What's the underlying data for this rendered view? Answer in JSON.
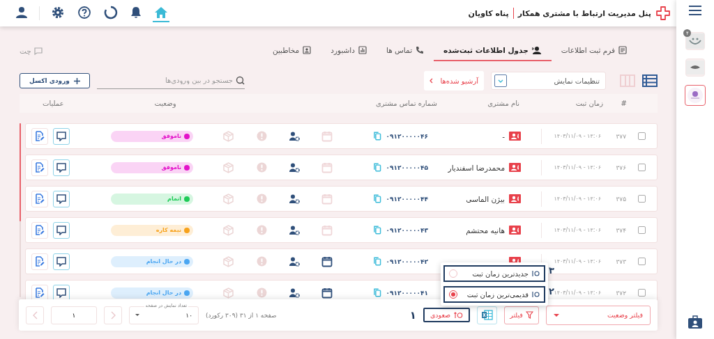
{
  "header": {
    "title": "پنل مدیریت ارتباط با مشتری همکار",
    "company": "پناه کاویان",
    "nav": [
      {
        "kind": "home",
        "selected": true
      },
      {
        "kind": "bell",
        "selected": false
      },
      {
        "kind": "loader",
        "selected": false
      },
      {
        "kind": "help",
        "selected": false
      },
      {
        "kind": "settings",
        "selected": false
      },
      {
        "kind": "user",
        "selected": false
      }
    ]
  },
  "sidebar": {
    "apps": [
      {
        "kind": "smile",
        "badge": "۴",
        "selected": false
      },
      {
        "kind": "eye",
        "selected": false
      },
      {
        "kind": "flower",
        "selected": true
      }
    ]
  },
  "tabs": [
    {
      "label": "فرم ثبت اطلاعات",
      "kind": "form",
      "selected": false
    },
    {
      "label": "جدول اطلاعات ثبت‌شده",
      "kind": "table",
      "selected": true
    },
    {
      "label": "تماس ها",
      "kind": "phone",
      "selected": false
    },
    {
      "label": "داشبورد",
      "kind": "chart",
      "selected": false
    },
    {
      "label": "مخاطبین",
      "kind": "contacts",
      "selected": false
    }
  ],
  "chat_link": "چت",
  "toolbar": {
    "views": [
      {
        "kind": "list",
        "selected": true
      },
      {
        "kind": "columns",
        "selected": false
      }
    ],
    "display_settings": "تنظیمات نمایش",
    "archive": "آرشیو شده‌ها",
    "search": {
      "placeholder": "جستجو در بین ورودی‌ها"
    },
    "excel_button": "ورودی اکسل"
  },
  "table": {
    "columns": [
      "#",
      "زمان ثبت",
      "نام مشتری",
      "شماره تماس مشتری",
      "وضعیت",
      "عملیات"
    ],
    "rows": [
      {
        "number": "۳۷۷",
        "time": "۱۴۰۳/۱۱/۰۹ - ۱۴:۰۶",
        "name": "-",
        "contact_icon": true,
        "phone": "۰۹۱۲۰۰۰۰۰۴۶",
        "scheduled": false,
        "checked": false,
        "status": {
          "label": "ناموفق",
          "color": "#e312c9"
        }
      },
      {
        "number": "۳۷۶",
        "time": "۱۴۰۳/۱۱/۰۹ - ۱۴:۰۶",
        "name": "محمدرضا اسفندیار",
        "contact_icon": true,
        "phone": "۰۹۱۲۰۰۰۰۰۴۵",
        "scheduled": false,
        "checked": false,
        "status": {
          "label": "ناموفق",
          "color": "#e312c9"
        }
      },
      {
        "number": "۳۷۵",
        "time": "۱۴۰۳/۱۱/۰۹ - ۱۴:۰۶",
        "name": "بیژن الماسی",
        "contact_icon": true,
        "phone": "۰۹۱۲۰۰۰۰۰۴۴",
        "scheduled": false,
        "checked": false,
        "status": {
          "label": "اتمام",
          "color": "#1ecb57"
        }
      },
      {
        "number": "۳۷۴",
        "time": "۱۴۰۳/۱۱/۰۹ - ۱۴:۰۶",
        "name": "هانیه محتشم",
        "contact_icon": true,
        "phone": "۰۹۱۲۰۰۰۰۰۴۳",
        "scheduled": false,
        "checked": false,
        "status": {
          "label": "نیمه کاره",
          "color": "#f7a21b"
        }
      },
      {
        "number": "۳۷۳",
        "time": "۱۴۰۳/۱۱/۰۹ - ۱۴:۰۶",
        "contact_icon": true,
        "phone": "۰۹۱۲۰۰۰۰۰۴۲",
        "scheduled": true,
        "checked": false,
        "status": {
          "label": "در حال انجام",
          "color": "#4aa6f2"
        }
      },
      {
        "number": "۳۷۲",
        "time": "۱۴۰۳/۱۱/۰۹ - ۱۴:۰۶",
        "contact_icon": false,
        "phone": "۰۹۱۲۰۰۰۰۰۴۱",
        "scheduled": true,
        "checked": false,
        "status": {
          "label": "در حال انجام",
          "color": "#4aa6f2"
        }
      }
    ]
  },
  "sort_menu": {
    "options": [
      {
        "label": "جدیدترین زمان ثبت",
        "marker": "۳",
        "highlighted": true,
        "selected": false
      },
      {
        "label": "قدیمی‌ترین زمان ثبت",
        "marker": "۲",
        "highlighted": true,
        "selected": true
      }
    ]
  },
  "footer": {
    "status_filter": "فیلتر وضعیت",
    "filter_button": "فیلتر",
    "sort_button": {
      "label": "صعودی",
      "marker": "۱",
      "highlighted": true
    },
    "page_info": "صفحه ۱ از ۳۱ (۳۰۹ رکورد)",
    "page_size": {
      "label": "تعداد نمایش در صفحه",
      "value": "۱۰"
    },
    "page": "۱"
  }
}
